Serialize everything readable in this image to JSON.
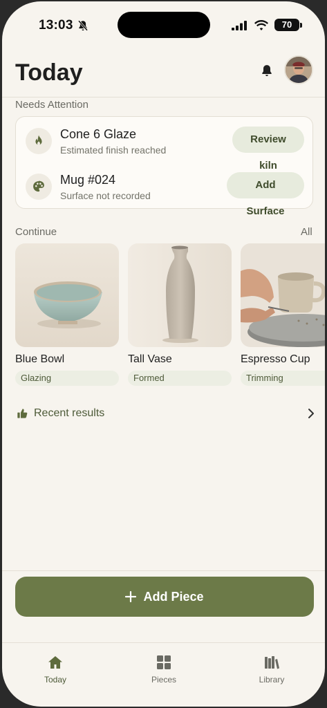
{
  "status_bar": {
    "time": "13:03",
    "battery": "70"
  },
  "header": {
    "title": "Today"
  },
  "needs_attention": {
    "label": "Needs Attention",
    "items": [
      {
        "title": "Cone 6 Glaze",
        "subtitle": "Estimated finish reached",
        "action": "Review kiln",
        "icon": "flame-icon"
      },
      {
        "title": "Mug #024",
        "subtitle": "Surface not recorded",
        "action": "Add Surface",
        "icon": "palette-icon"
      }
    ]
  },
  "continue": {
    "label": "Continue",
    "all_label": "All",
    "pieces": [
      {
        "name": "Blue Bowl",
        "status": "Glazing"
      },
      {
        "name": "Tall Vase",
        "status": "Formed"
      },
      {
        "name": "Espresso Cup",
        "status": "Trimming"
      }
    ]
  },
  "recent": {
    "label": "Recent results"
  },
  "add_piece": {
    "label": "Add Piece"
  },
  "tabs": [
    {
      "label": "Today",
      "icon": "home-icon",
      "active": true
    },
    {
      "label": "Pieces",
      "icon": "grid-icon",
      "active": false
    },
    {
      "label": "Library",
      "icon": "library-icon",
      "active": false
    }
  ],
  "colors": {
    "accent": "#6c7a48",
    "background": "#f7f4ee",
    "chip": "#e7ebdd"
  }
}
